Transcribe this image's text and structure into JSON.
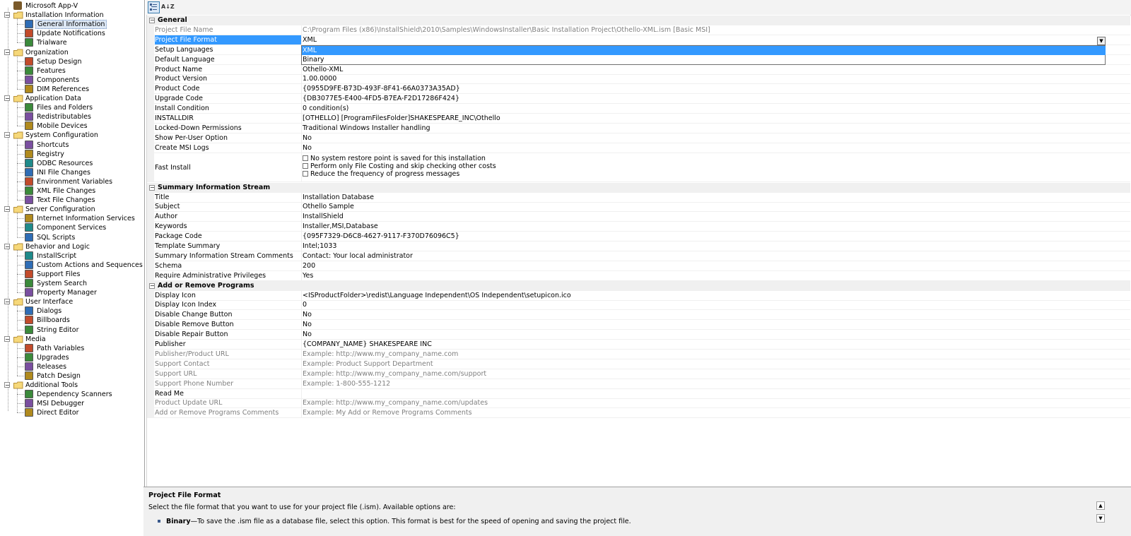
{
  "tree": {
    "root": "Microsoft App-V",
    "groups": [
      {
        "label": "Installation Information",
        "items": [
          "General Information",
          "Update Notifications",
          "Trialware"
        ]
      },
      {
        "label": "Organization",
        "items": [
          "Setup Design",
          "Features",
          "Components",
          "DIM References"
        ]
      },
      {
        "label": "Application Data",
        "items": [
          "Files and Folders",
          "Redistributables",
          "Mobile Devices"
        ]
      },
      {
        "label": "System Configuration",
        "items": [
          "Shortcuts",
          "Registry",
          "ODBC Resources",
          "INI File Changes",
          "Environment Variables",
          "XML File Changes",
          "Text File Changes"
        ]
      },
      {
        "label": "Server Configuration",
        "items": [
          "Internet Information Services",
          "Component Services",
          "SQL Scripts"
        ]
      },
      {
        "label": "Behavior and Logic",
        "items": [
          "InstallScript",
          "Custom Actions and Sequences",
          "Support Files",
          "System Search",
          "Property Manager"
        ]
      },
      {
        "label": "User Interface",
        "items": [
          "Dialogs",
          "Billboards",
          "String Editor"
        ]
      },
      {
        "label": "Media",
        "items": [
          "Path Variables",
          "Upgrades",
          "Releases",
          "Patch Design"
        ]
      },
      {
        "label": "Additional Tools",
        "items": [
          "Dependency Scanners",
          "MSI Debugger",
          "Direct Editor"
        ]
      }
    ],
    "selected": "General Information"
  },
  "toolbar": {
    "categorized_label": "Categorized",
    "alpha_label": "A↓Z"
  },
  "sections": [
    {
      "title": "General",
      "rows": [
        {
          "name": "Project File Name",
          "value": "C:\\Program Files (x86)\\InstallShield\\2010\\Samples\\WindowsInstaller\\Basic Installation Project\\Othello-XML.ism [Basic MSI]",
          "dim": true
        },
        {
          "name": "Project File Format",
          "value": "XML",
          "selected": true
        },
        {
          "name": "Setup Languages",
          "value": ""
        },
        {
          "name": "Default Language",
          "value": ""
        },
        {
          "name": "Product Name",
          "value": "Othello-XML"
        },
        {
          "name": "Product Version",
          "value": "1.00.0000"
        },
        {
          "name": "Product Code",
          "value": "{0955D9FE-B73D-493F-8F41-66A0373A35AD}"
        },
        {
          "name": "Upgrade Code",
          "value": "{DB3077E5-E400-4FD5-B7EA-F2D17286F424}"
        },
        {
          "name": "Install Condition",
          "value": "0 condition(s)"
        },
        {
          "name": "INSTALLDIR",
          "value": "[OTHELLO]  [ProgramFilesFolder]SHAKESPEARE_INC\\Othello"
        },
        {
          "name": "Locked-Down Permissions",
          "value": "Traditional Windows Installer handling"
        },
        {
          "name": "Show Per-User Option",
          "value": "No"
        },
        {
          "name": "Create MSI Logs",
          "value": "No"
        }
      ]
    },
    {
      "title": "Summary Information Stream",
      "rows": [
        {
          "name": "Title",
          "value": "Installation Database"
        },
        {
          "name": "Subject",
          "value": "Othello Sample"
        },
        {
          "name": "Author",
          "value": "InstallShield"
        },
        {
          "name": "Keywords",
          "value": "Installer,MSI,Database"
        },
        {
          "name": "Package Code",
          "value": "{095F7329-D6C8-4627-9117-F370D76096C5}"
        },
        {
          "name": "Template Summary",
          "value": "Intel;1033"
        },
        {
          "name": "Summary Information Stream Comments",
          "value": "Contact:  Your local administrator"
        },
        {
          "name": "Schema",
          "value": "200"
        },
        {
          "name": "Require Administrative Privileges",
          "value": "Yes"
        }
      ]
    },
    {
      "title": "Add or Remove Programs",
      "rows": [
        {
          "name": "Display Icon",
          "value": "<ISProductFolder>\\redist\\Language Independent\\OS Independent\\setupicon.ico"
        },
        {
          "name": "Display Icon Index",
          "value": "0"
        },
        {
          "name": "Disable Change Button",
          "value": "No"
        },
        {
          "name": "Disable Remove Button",
          "value": "No"
        },
        {
          "name": "Disable Repair Button",
          "value": "No"
        },
        {
          "name": "Publisher",
          "value": "{COMPANY_NAME} SHAKESPEARE INC"
        },
        {
          "name": "Publisher/Product URL",
          "value": "Example: http://www.my_company_name.com",
          "dim": true
        },
        {
          "name": "Support Contact",
          "value": "Example: Product Support Department",
          "dim": true
        },
        {
          "name": "Support URL",
          "value": "Example: http://www.my_company_name.com/support",
          "dim": true
        },
        {
          "name": "Support Phone Number",
          "value": "Example: 1-800-555-1212",
          "dim": true
        },
        {
          "name": "Read Me",
          "value": ""
        },
        {
          "name": "Product Update URL",
          "value": "Example: http://www.my_company_name.com/updates",
          "dim": true
        },
        {
          "name": "Add or Remove Programs Comments",
          "value": "Example: My Add or Remove Programs Comments",
          "dim": true
        }
      ]
    }
  ],
  "fast_install": {
    "name": "Fast Install",
    "options": [
      "No system restore point is saved for this installation",
      "Perform only File Costing and skip checking other costs",
      "Reduce the frequency of progress messages"
    ]
  },
  "dropdown": {
    "options": [
      "XML",
      "Binary"
    ],
    "highlighted": "XML",
    "arrow": "▼"
  },
  "help": {
    "title": "Project File Format",
    "description": "Select the file format that you want to use for your project file (.ism). Available options are:",
    "bullet_term": "Binary",
    "bullet_text": "—To save the .ism file as a database file, select this option. This format is best for the speed of opening and saving the project file."
  }
}
